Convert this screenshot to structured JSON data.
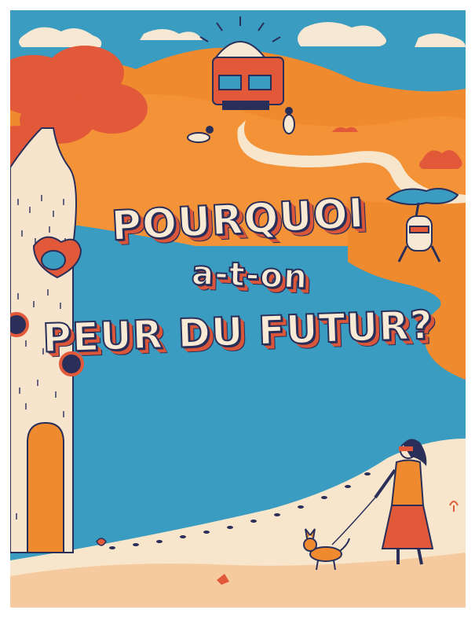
{
  "title": {
    "line1": "POURQUOI",
    "line2": "a-t-on",
    "line3": "PEUR DU FUTUR?"
  },
  "illustration": {
    "palette": {
      "sky": "#3a9cc0",
      "hills": "#f08a2e",
      "river": "#3a9cc0",
      "path": "#f8e6cc",
      "tree_foliage": "#e2593a",
      "trunk": "#f6e4cc",
      "ink": "#2a2f5a",
      "accent_red": "#d9563a"
    },
    "elements": [
      "observatory",
      "tree-house",
      "woman-walking-dog",
      "flying-figures",
      "small-tree-robot"
    ]
  }
}
